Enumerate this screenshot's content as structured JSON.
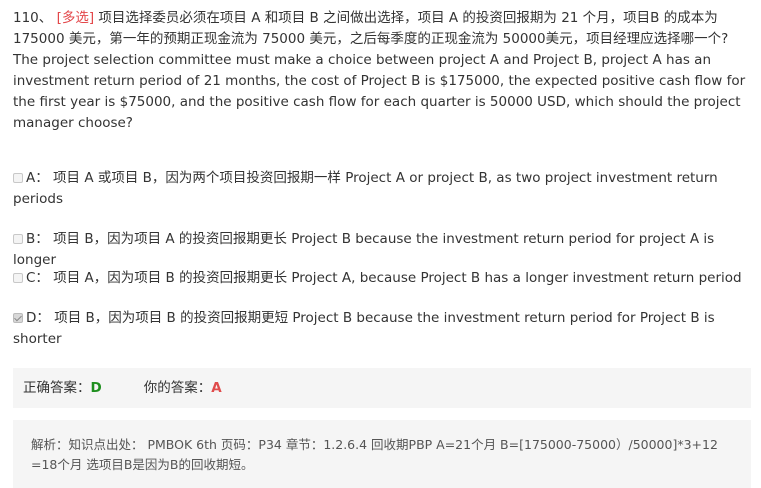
{
  "question": {
    "number": "110、",
    "tag": "[多选]",
    "text_cn": "项目选择委员必须在项目 A 和项目 B 之间做出选择，项目 A 的投资回报期为 21 个月，项目B 的成本为 175000 美元，第一年的预期正现金流为 75000 美元，之后每季度的正现金流为 50000美元，项目经理应选择哪一个?",
    "text_en": "The project selection committee must make a choice between project A and Project B, project A has an investment return period of 21 months, the cost of Project B is $175000, the expected positive cash flow for the first year is $75000, and the positive cash flow for each quarter is 50000 USD, which should the project manager choose?"
  },
  "options": [
    {
      "letter": "A：",
      "text": "项目 A 或项目 B，因为两个项目投资回报期一样 Project A or project B, as two project investment return periods",
      "checked": false
    },
    {
      "letter": "B：",
      "text": "项目 B，因为项目 A 的投资回报期更长 Project B because the investment return period for project A is longer",
      "checked": false
    },
    {
      "letter": "C：",
      "text": "项目 A，因为项目 B 的投资回报期更长 Project A, because Project B has a longer investment return period",
      "checked": false
    },
    {
      "letter": "D：",
      "text": "项目 B，因为项目 B 的投资回报期更短 Project B because the investment return period for Project B is shorter",
      "checked": true
    }
  ],
  "answer": {
    "correct_label": "正确答案：",
    "correct_value": "D",
    "yours_label": "你的答案：",
    "yours_value": "A"
  },
  "explanation": "解析：知识点出处：  PMBOK 6th 页码：P34 章节：1.2.6.4 回收期PBP A=21个月 B=[175000-75000）/50000]*3+12 =18个月 选项目B是因为B的回收期短。"
}
